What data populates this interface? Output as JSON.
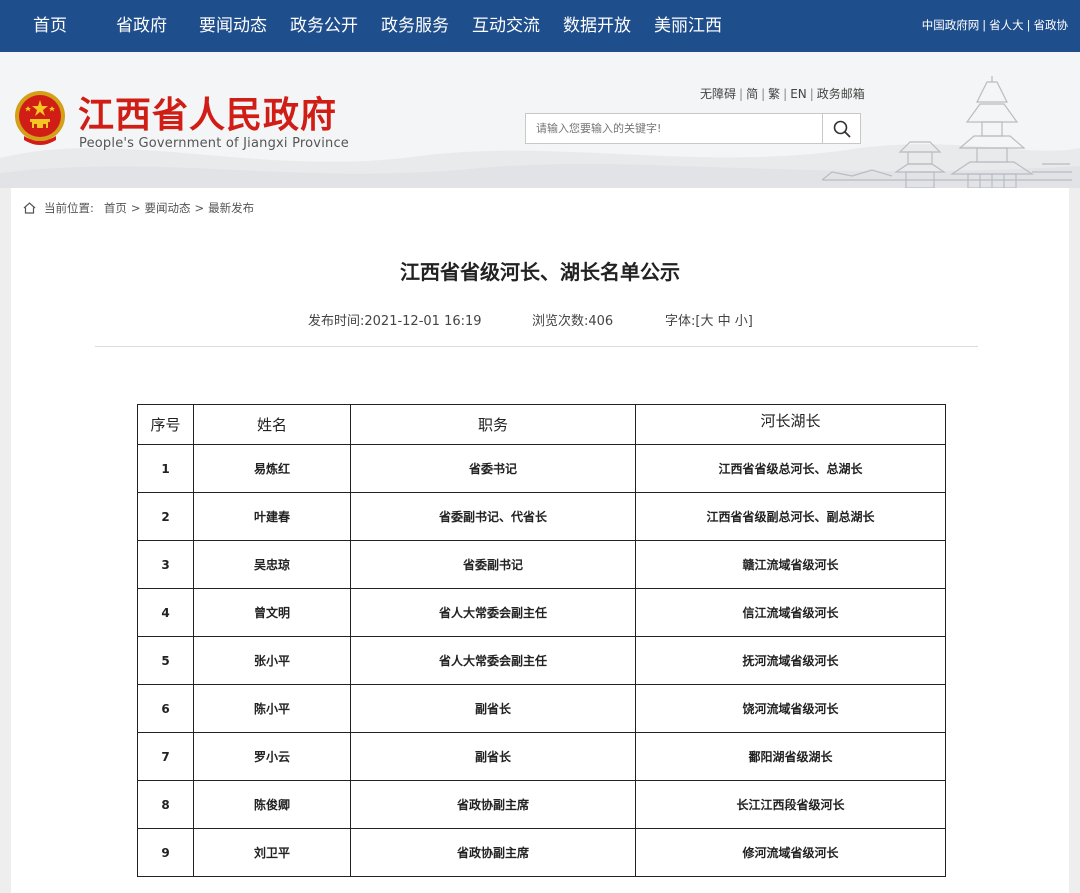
{
  "top_nav": {
    "items": [
      "首页",
      "省政府",
      "要闻动态",
      "政务公开",
      "政务服务",
      "互动交流",
      "数据开放",
      "美丽江西"
    ],
    "links": [
      "中国政府网",
      "省人大",
      "省政协"
    ]
  },
  "header": {
    "site_title": "江西省人民政府",
    "site_subtitle": "People's Government of Jiangxi Province",
    "util_links": [
      "无障碍",
      "简",
      "繁",
      "EN",
      "政务邮箱"
    ],
    "search_placeholder": "请输入您要输入的关键字!"
  },
  "breadcrumb": {
    "label": "当前位置:",
    "items": [
      "首页",
      "要闻动态",
      "最新发布"
    ]
  },
  "article": {
    "title": "江西省省级河长、湖长名单公示",
    "publish_time_label": "发布时间:",
    "publish_time": "2021-12-01 16:19",
    "views_label": "浏览次数:",
    "views": "406",
    "font_label": "字体:",
    "font_sizes": [
      "大",
      "中",
      "小"
    ]
  },
  "table": {
    "headers": [
      "序号",
      "姓名",
      "职务",
      "河长湖长"
    ],
    "rows": [
      [
        "1",
        "易炼红",
        "省委书记",
        "江西省省级总河长、总湖长"
      ],
      [
        "2",
        "叶建春",
        "省委副书记、代省长",
        "江西省省级副总河长、副总湖长"
      ],
      [
        "3",
        "吴忠琼",
        "省委副书记",
        "赣江流域省级河长"
      ],
      [
        "4",
        "曾文明",
        "省人大常委会副主任",
        "信江流域省级河长"
      ],
      [
        "5",
        "张小平",
        "省人大常委会副主任",
        "抚河流域省级河长"
      ],
      [
        "6",
        "陈小平",
        "副省长",
        "饶河流域省级河长"
      ],
      [
        "7",
        "罗小云",
        "副省长",
        "鄱阳湖省级湖长"
      ],
      [
        "8",
        "陈俊卿",
        "省政协副主席",
        "长江江西段省级河长"
      ],
      [
        "9",
        "刘卫平",
        "省政协副主席",
        "修河流域省级河长"
      ]
    ]
  },
  "colors": {
    "nav_bg": "#1f4e8c",
    "title_red": "#d01e16",
    "header_bg": "#f4f5f6"
  }
}
